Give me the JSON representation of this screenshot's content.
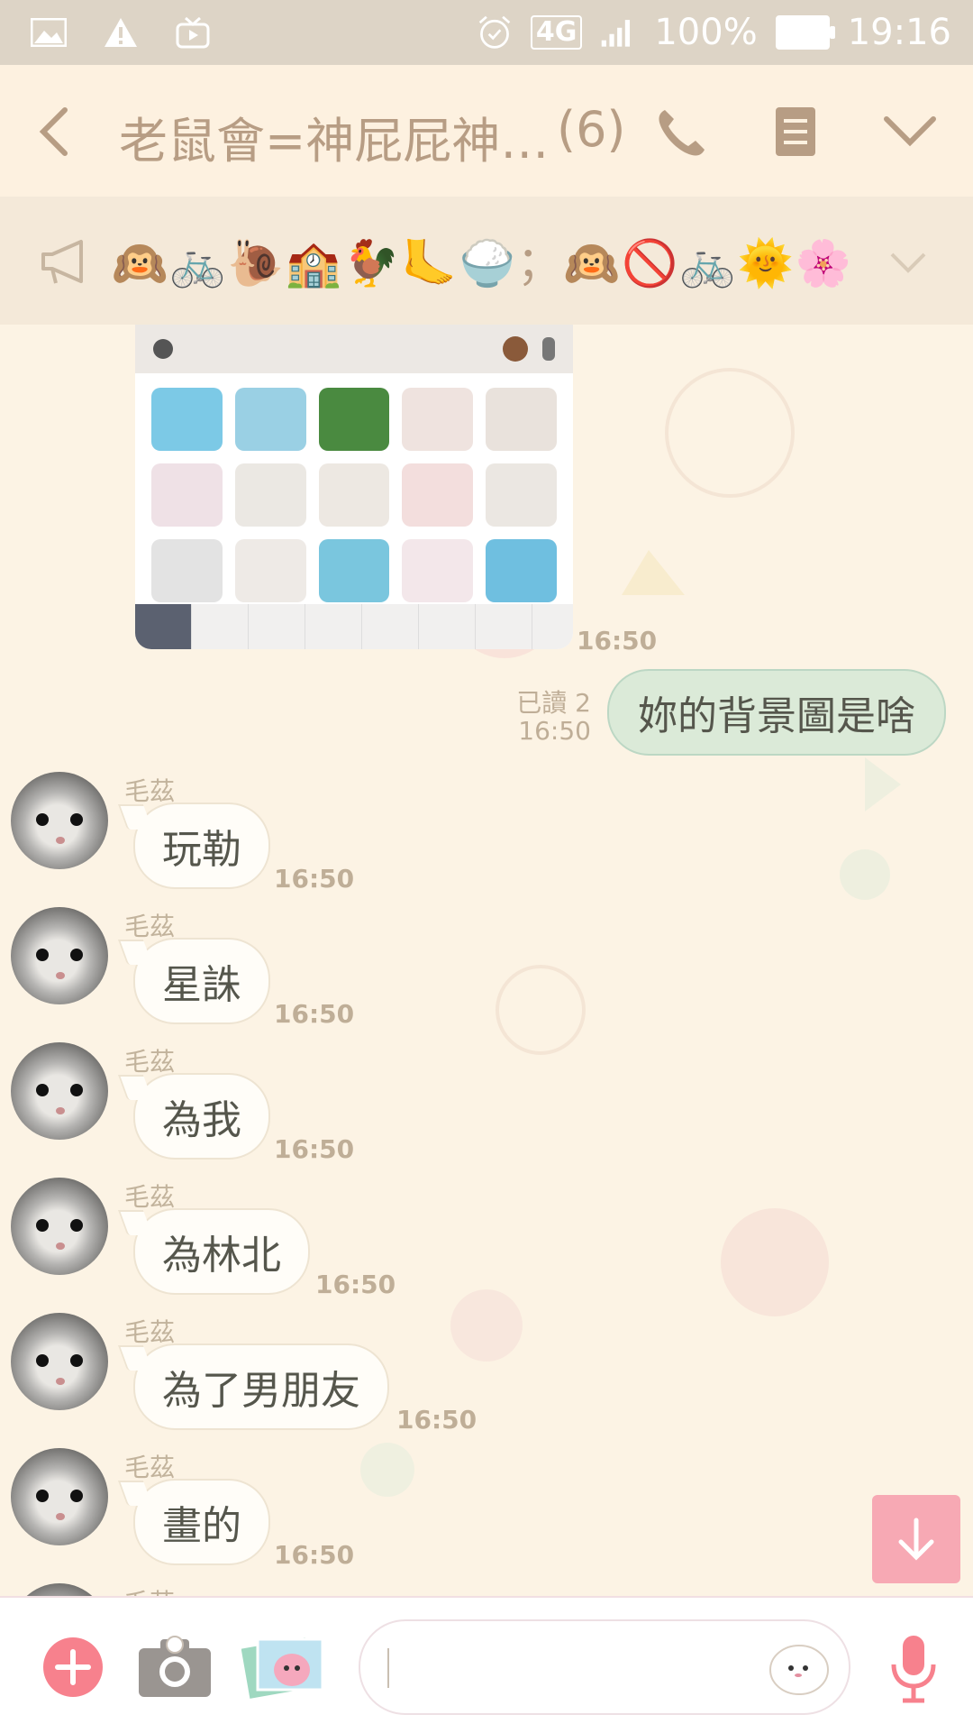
{
  "status_bar": {
    "time": "19:16",
    "battery": "100%",
    "network": "4G",
    "icons": [
      "gallery-icon",
      "warning-icon",
      "tv-icon",
      "alarm-icon",
      "signal-icon",
      "battery-icon"
    ]
  },
  "header": {
    "title": "老鼠會=神屁屁神…",
    "member_count": "(6)",
    "icons": [
      "back-arrow-icon",
      "phone-icon",
      "note-icon",
      "chevron-down-icon"
    ]
  },
  "announcement": {
    "text": "🙉🚲🐌🏫🐓🦶🍚；🙉🚫🚲🌞🌸",
    "icon": "megaphone-icon"
  },
  "messages": {
    "shared_image_time": "16:50",
    "outgoing": {
      "read": "已讀 2",
      "time": "16:50",
      "text": "妳的背景圖是啥"
    },
    "incoming": [
      {
        "sender": "毛茲",
        "text": "玩勒",
        "time": "16:50"
      },
      {
        "sender": "毛茲",
        "text": "星誅",
        "time": "16:50"
      },
      {
        "sender": "毛茲",
        "text": "為我",
        "time": "16:50"
      },
      {
        "sender": "毛茲",
        "text": "為林北",
        "time": "16:50"
      },
      {
        "sender": "毛茲",
        "text": "為了男朋友",
        "time": "16:50"
      },
      {
        "sender": "毛茲",
        "text": "畫的",
        "time": "16:50"
      },
      {
        "sender": "毛茲",
        "text": "",
        "time": ""
      }
    ]
  },
  "input_bar": {
    "placeholder": "",
    "icons": [
      "plus-icon",
      "camera-icon",
      "image-icon",
      "sticker-icon",
      "mic-icon"
    ]
  },
  "colors": {
    "accent_pink": "#f7818d",
    "outgoing_bubble": "#dbead8",
    "header_text": "#b79d84"
  }
}
